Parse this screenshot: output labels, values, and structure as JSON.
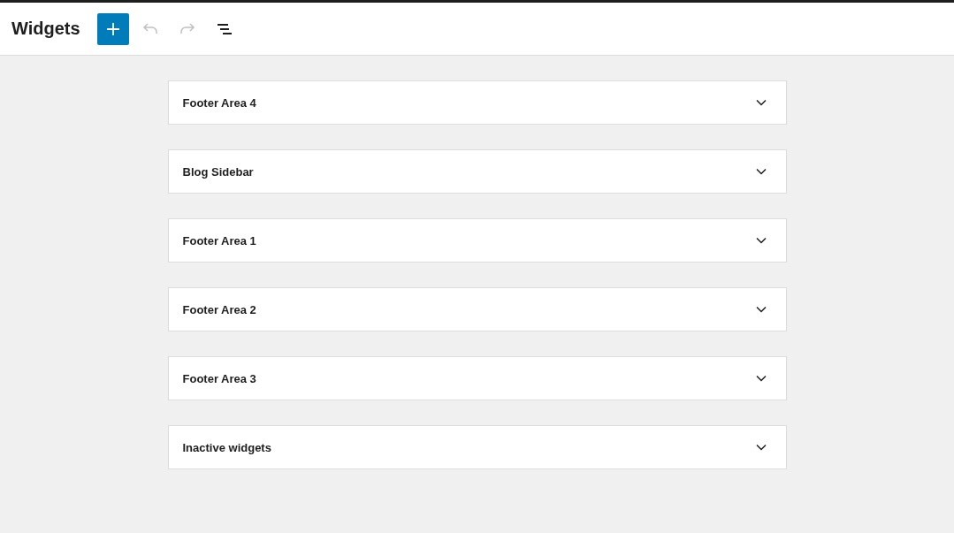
{
  "header": {
    "title": "Widgets",
    "tools": [
      {
        "kind": "add",
        "disabled": false
      },
      {
        "kind": "undo",
        "disabled": true
      },
      {
        "kind": "redo",
        "disabled": true
      },
      {
        "kind": "list",
        "disabled": false
      }
    ]
  },
  "areas": [
    {
      "title": "Footer Area 4",
      "expanded": false
    },
    {
      "title": "Blog Sidebar",
      "expanded": false
    },
    {
      "title": "Footer Area 1",
      "expanded": false
    },
    {
      "title": "Footer Area 2",
      "expanded": false
    },
    {
      "title": "Footer Area 3",
      "expanded": false
    },
    {
      "title": "Inactive widgets",
      "expanded": false
    }
  ]
}
